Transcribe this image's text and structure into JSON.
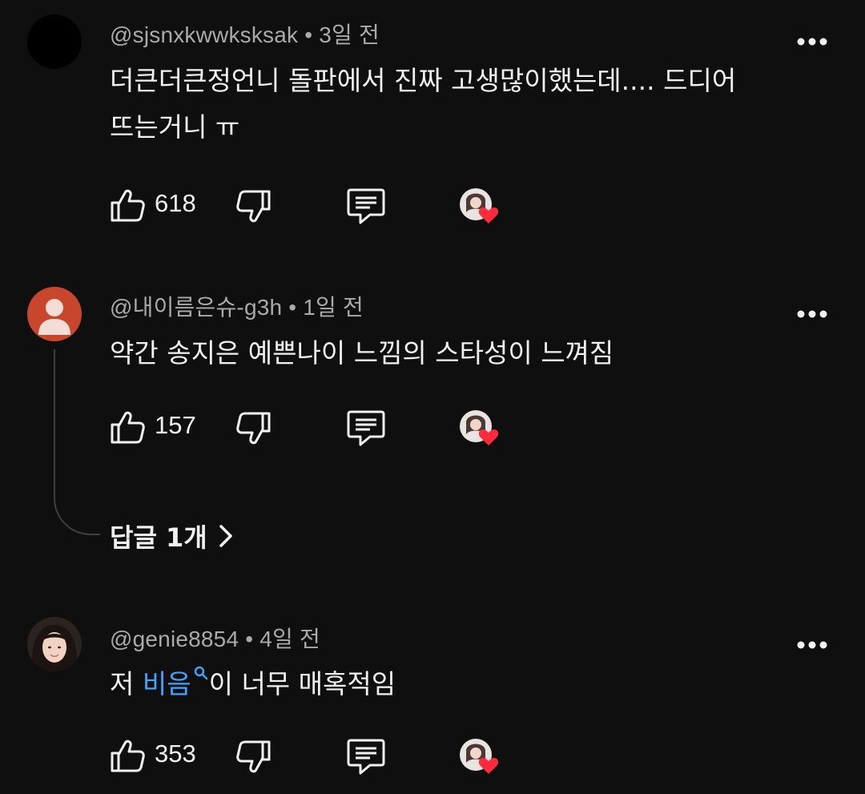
{
  "comments": [
    {
      "handle": "@sjsnxkwwksksak",
      "time": "3일 전",
      "text_lines": [
        "더큰더큰정언니 돌판에서 진짜 고생많이했는데.... 드디어",
        "뜨는거니 ㅠ"
      ],
      "likes": "618",
      "avatar": "black-circle"
    },
    {
      "handle": "@내이름은슈-g3h",
      "time": "1일 전",
      "text_lines": [
        "약간 송지은 예쁜나이 느낌의 스타성이 느껴짐"
      ],
      "likes": "157",
      "avatar": "default-person-icon",
      "replies_label": "답글 1개"
    },
    {
      "handle": "@genie8854",
      "time": "4일 전",
      "text_before": "저 ",
      "text_link": "비음",
      "text_after": "이 너무 매혹적임",
      "likes": "353",
      "avatar": "photo"
    }
  ],
  "icons": {
    "like": "thumbs-up-icon",
    "dislike": "thumbs-down-icon",
    "reply": "comment-icon",
    "more": "more-vertical-icon",
    "creator_heart": "creator-heart-icon",
    "search_hint": "search-icon",
    "chevron": "chevron-right-icon"
  },
  "colors": {
    "background": "#0f0f0f",
    "text": "#f1f1f1",
    "muted": "#aaaaaa",
    "link": "#3ea6ff",
    "heart": "#ff2a3b",
    "default_avatar": "#c8472c"
  }
}
